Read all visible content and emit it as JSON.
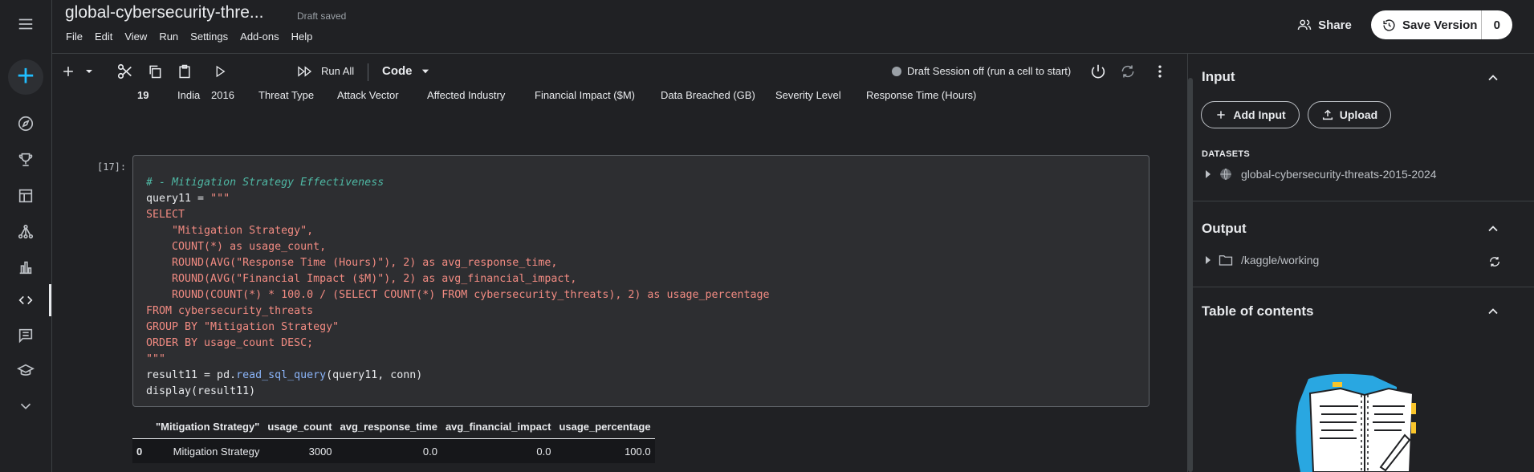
{
  "app": {
    "title": "global-cybersecurity-thre...",
    "draft_status": "Draft saved",
    "menu": [
      "File",
      "Edit",
      "View",
      "Run",
      "Settings",
      "Add-ons",
      "Help"
    ],
    "share_label": "Share",
    "save_version_label": "Save Version",
    "save_version_count": "0"
  },
  "rail": {
    "items": [
      "menu-icon",
      "create-icon",
      "compass-icon",
      "trophy-icon",
      "table-icon",
      "models-icon",
      "chart-icon",
      "code-icon",
      "comments-icon",
      "learn-icon",
      "more-icon"
    ],
    "active": "code-icon"
  },
  "toolbar": {
    "run_all_label": "Run All",
    "cell_type": "Code",
    "session_status": "Draft Session off (run a cell to start)"
  },
  "previous_output_row": {
    "index": "19",
    "cells": [
      "India",
      "2016",
      "Threat Type",
      "Attack Vector",
      "Affected Industry",
      "Financial Impact ($M)",
      "Data Breached (GB)",
      "Severity Level",
      "Response Time (Hours)"
    ]
  },
  "cell": {
    "execution_count": "[17]:",
    "comment": "# - Mitigation Strategy Effectiveness",
    "line_assign": "query11 = ",
    "str_open": "\"\"\"",
    "sql_lines": [
      "SELECT",
      "    \"Mitigation Strategy\",",
      "    COUNT(*) as usage_count,",
      "    ROUND(AVG(\"Response Time (Hours)\"), 2) as avg_response_time,",
      "    ROUND(AVG(\"Financial Impact ($M)\"), 2) as avg_financial_impact,",
      "    ROUND(COUNT(*) * 100.0 / (SELECT COUNT(*) FROM cybersecurity_threats), 2) as usage_percentage",
      "FROM cybersecurity_threats",
      "GROUP BY \"Mitigation Strategy\"",
      "ORDER BY usage_count DESC;",
      "\"\"\""
    ],
    "result_prefix": "result11 = pd.",
    "result_fn": "read_sql_query",
    "result_suffix": "(query11, conn)",
    "display_line": "display(result11)"
  },
  "output_table": {
    "columns": [
      "",
      "\"Mitigation Strategy\"",
      "usage_count",
      "avg_response_time",
      "avg_financial_impact",
      "usage_percentage"
    ],
    "rows": [
      [
        "0",
        "Mitigation Strategy",
        "3000",
        "0.0",
        "0.0",
        "100.0"
      ]
    ]
  },
  "right_panel": {
    "input_title": "Input",
    "add_input_label": "Add Input",
    "upload_label": "Upload",
    "datasets_label": "DATASETS",
    "dataset_name": "global-cybersecurity-threats-2015-2024",
    "output_title": "Output",
    "output_path": "/kaggle/working",
    "toc_title": "Table of contents"
  }
}
